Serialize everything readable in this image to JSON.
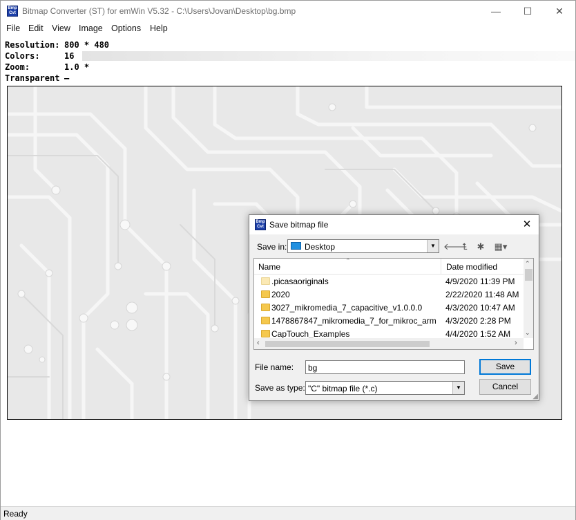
{
  "window": {
    "title": "Bitmap Converter (ST) for emWin V5.32 - C:\\Users\\Jovan\\Desktop\\bg.bmp",
    "icon_text": "Bmp Cvt",
    "controls": {
      "minimize": "—",
      "maximize": "☐",
      "close": "✕"
    }
  },
  "menu": [
    "File",
    "Edit",
    "View",
    "Image",
    "Options",
    "Help"
  ],
  "info": {
    "resolution_label": "Resolution:",
    "resolution_value": "800 * 480",
    "colors_label": "Colors:",
    "colors_value": "16",
    "zoom_label": "Zoom:",
    "zoom_value": "1.0 *",
    "transparent_label": "Transparent",
    "transparent_value": "—"
  },
  "status": "Ready",
  "dialog": {
    "title": "Save bitmap file",
    "close": "✕",
    "save_in_label": "Save in:",
    "save_in_value": "Desktop",
    "columns": {
      "name": "Name",
      "date": "Date modified"
    },
    "files": [
      {
        "name": ".picasaoriginals",
        "date": "4/9/2020 11:39 PM",
        "icon": "folder-pale-icon"
      },
      {
        "name": "2020",
        "date": "2/22/2020 11:48 AM",
        "icon": "folder-icon"
      },
      {
        "name": "3027_mikromedia_7_capacitive_v1.0.0.0",
        "date": "4/3/2020 10:47 AM",
        "icon": "folder-icon"
      },
      {
        "name": "1478867847_mikromedia_7_for_mikroc_arm",
        "date": "4/3/2020 2:28 PM",
        "icon": "folder-icon"
      },
      {
        "name": "CapTouch_Examples",
        "date": "4/4/2020 1:52 AM",
        "icon": "folder-icon"
      }
    ],
    "file_name_label": "File name:",
    "file_name_value": "bg",
    "save_type_label": "Save as type:",
    "save_type_value": "\"C\" bitmap file (*.c)",
    "save_button": "Save",
    "cancel_button": "Cancel"
  }
}
